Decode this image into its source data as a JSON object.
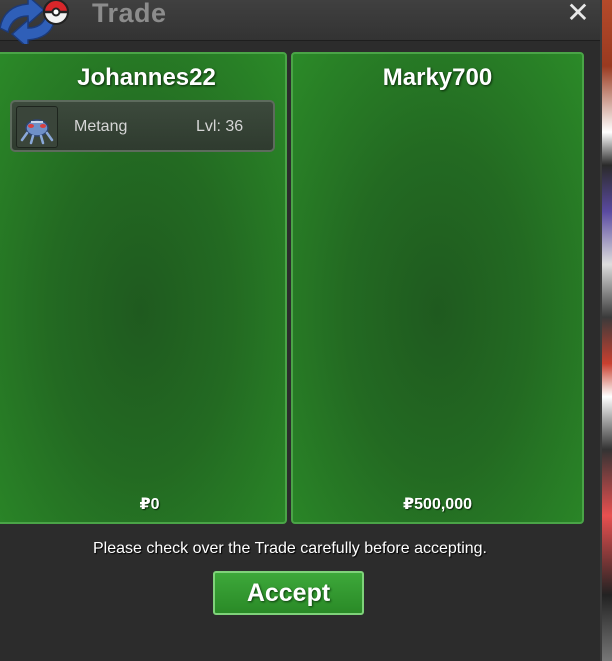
{
  "window": {
    "title": "Trade",
    "close_icon": "✕"
  },
  "left_panel": {
    "player_name": "Johannes22",
    "items": [
      {
        "name": "Metang",
        "level": "Lvl: 36",
        "icon": "metang-sprite-icon"
      }
    ],
    "money": "₽0"
  },
  "right_panel": {
    "player_name": "Marky700",
    "items": [],
    "money": "₽500,000"
  },
  "footer": {
    "notice": "Please check over the Trade carefully before accepting.",
    "accept_label": "Accept"
  },
  "colors": {
    "panel_green": "#236a22",
    "panel_border": "#4aa447",
    "accept_green": "#3da83a"
  }
}
